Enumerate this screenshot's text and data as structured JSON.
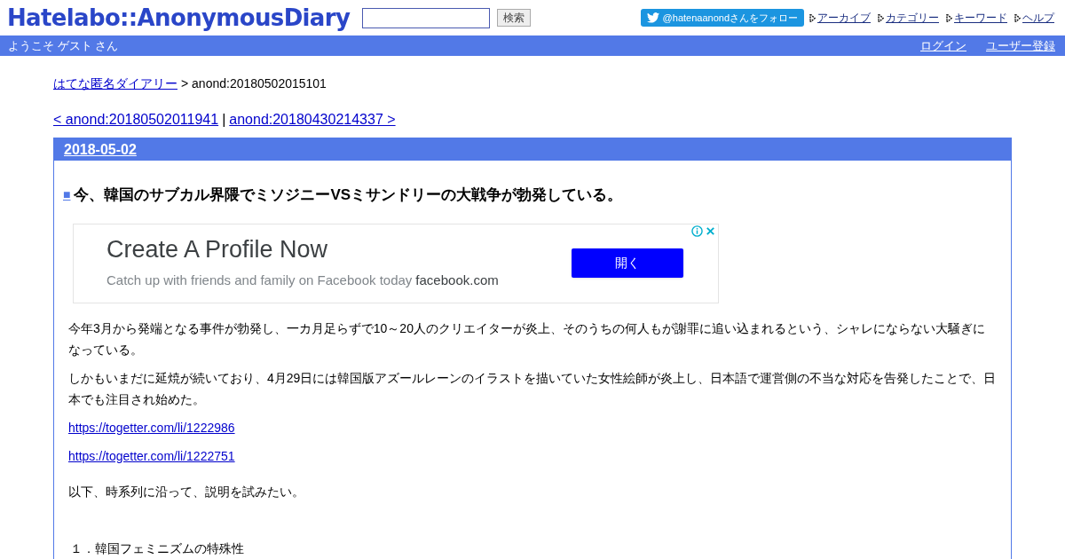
{
  "header": {
    "logo": "Hatelabo::AnonymousDiary",
    "search_button": "検索",
    "follow_button": "@hatenaanondさんをフォロー",
    "nav_links": [
      "アーカイブ",
      "カテゴリー",
      "キーワード",
      "ヘルプ"
    ]
  },
  "userbar": {
    "welcome": "ようこそ ゲスト さん",
    "links": [
      "ログイン",
      "ユーザー登録"
    ]
  },
  "breadcrumb": {
    "link": "はてな匿名ダイアリー",
    "current": "> anond:20180502015101"
  },
  "pager": {
    "prev": "< anond:20180502011941",
    "separator": "|",
    "next": "anond:20180430214337 >"
  },
  "entry": {
    "date": "2018-05-02",
    "title_mark": "■",
    "title": "今、韓国のサブカル界隈でミソジニーVSミサンドリーの大戦争が勃発している。",
    "ad": {
      "headline": "Create A Profile Now",
      "description": "Catch up with friends and family on Facebook today",
      "domain": "facebook.com",
      "button": "開く"
    },
    "body": [
      {
        "kind": "text",
        "text": "今年3月から発端となる事件が勃発し、一カ月足らずで10～20人のクリエイターが炎上、そのうちの何人もが謝罪に追い込まれるという、シャレにならない大騒ぎになっている。"
      },
      {
        "kind": "text",
        "text": "しかもいまだに延焼が続いており、4月29日には韓国版アズールレーンのイラストを描いていた女性絵師が炎上し、日本語で運営側の不当な対応を告発したことで、日本でも注目され始めた。"
      },
      {
        "kind": "link",
        "text": "https://togetter.com/li/1222986"
      },
      {
        "kind": "link",
        "text": "https://togetter.com/li/1222751"
      },
      {
        "kind": "text",
        "text": "以下、時系列に沿って、説明を試みたい。"
      },
      {
        "kind": "heading",
        "text": "１．韓国フェミニズムの特殊性"
      }
    ]
  }
}
